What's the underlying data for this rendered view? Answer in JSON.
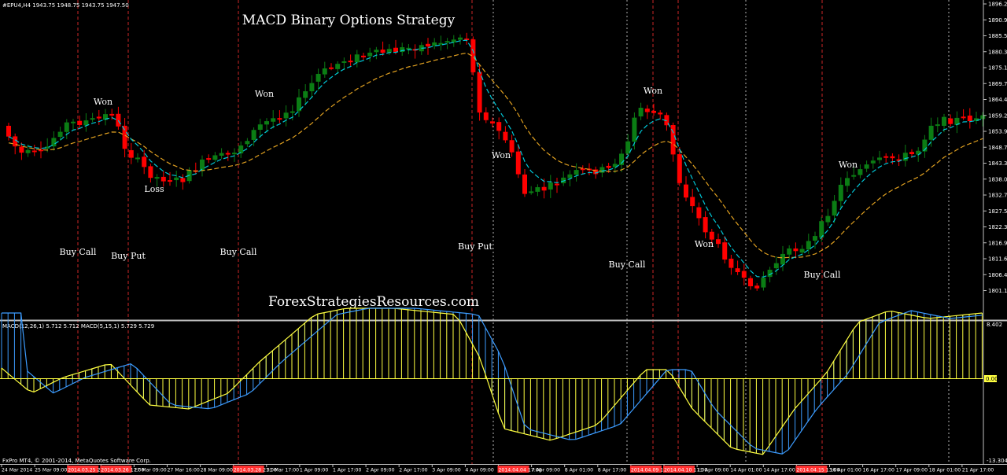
{
  "window": {
    "symbol_header": "#EPU4,H4  1943.75 1948.75 1943.75 1947.50",
    "title": "MACD Binary Options Strategy",
    "watermark": "ForexStrategiesResources.com",
    "copyright": "FxPro MT4, © 2001-2014, MetaQuotes Software Corp."
  },
  "colors": {
    "background": "#000000",
    "bull": "#0b7d14",
    "bear": "#ff0000",
    "ma_fast": "#00c8d8",
    "ma_slow": "#e0a020",
    "macd_hist": "#ffff40",
    "macd_signal": "#3c9cff",
    "signal_line": "#ff3030",
    "separator": "#c0c0c0"
  },
  "price_axis": {
    "labels": [
      "1896.25",
      "1890.90",
      "1885.55",
      "1880.35",
      "1875.10",
      "1869.75",
      "1864.45",
      "1859.20",
      "1853.90",
      "1848.70",
      "1843.35",
      "1838.05",
      "1832.75",
      "1827.55",
      "1822.30",
      "1816.95",
      "1811.65",
      "1806.40",
      "1801.15"
    ]
  },
  "macd_panel": {
    "legend": "MACD(12,26,1) 5.712 5.712  MACD(5,15,1) 5.729 5.729",
    "axis_top": "8.402",
    "axis_zero": "0.00",
    "axis_bottom": "-13.304"
  },
  "time_axis": {
    "labels": [
      {
        "text": "24 Mar 2014",
        "hl": false
      },
      {
        "text": "25 Mar 09:00",
        "hl": false
      },
      {
        "text": "2014.03.25 21:00",
        "hl": true
      },
      {
        "text": "2014.03.26 17:00",
        "hl": true
      },
      {
        "text": "27 Mar 09:00",
        "hl": false
      },
      {
        "text": "27 Mar 16:00",
        "hl": false
      },
      {
        "text": "28 Mar 09:00",
        "hl": false
      },
      {
        "text": "2014.03.28 21:00",
        "hl": true
      },
      {
        "text": "31 Mar 17:00",
        "hl": false
      },
      {
        "text": "1 Apr 09:00",
        "hl": false
      },
      {
        "text": "1 Apr 17:00",
        "hl": false
      },
      {
        "text": "2 Apr 09:00",
        "hl": false
      },
      {
        "text": "2 Apr 17:00",
        "hl": false
      },
      {
        "text": "3 Apr 09:00",
        "hl": false
      },
      {
        "text": "4 Apr 09:00",
        "hl": false
      },
      {
        "text": "2014.04.04 17:00",
        "hl": true
      },
      {
        "text": "7 Apr 09:00",
        "hl": false
      },
      {
        "text": "8 Apr 01:00",
        "hl": false
      },
      {
        "text": "8 Apr 17:00",
        "hl": false
      },
      {
        "text": "2014.04.09 17:00",
        "hl": true
      },
      {
        "text": "2014.04.10 17:00",
        "hl": true
      },
      {
        "text": "11 Apr 09:00",
        "hl": false
      },
      {
        "text": "14 Apr 01:00",
        "hl": false
      },
      {
        "text": "14 Apr 17:00",
        "hl": false
      },
      {
        "text": "2014.04.15 13:00",
        "hl": true
      },
      {
        "text": "16 Apr 01:00",
        "hl": false
      },
      {
        "text": "16 Apr 17:00",
        "hl": false
      },
      {
        "text": "17 Apr 09:00",
        "hl": false
      },
      {
        "text": "18 Apr 01:00",
        "hl": false
      },
      {
        "text": "21 Apr 17:00",
        "hl": false
      }
    ]
  },
  "annotations": [
    {
      "text": "Won"
    },
    {
      "text": "Buy Call"
    },
    {
      "text": "Buy Put"
    },
    {
      "text": "Loss"
    },
    {
      "text": "Won"
    },
    {
      "text": "Buy Call"
    },
    {
      "text": "Buy Put"
    },
    {
      "text": "Won"
    },
    {
      "text": "Won"
    },
    {
      "text": "Buy Call"
    },
    {
      "text": "Won"
    },
    {
      "text": "Won"
    },
    {
      "text": "Buy Call"
    }
  ]
}
